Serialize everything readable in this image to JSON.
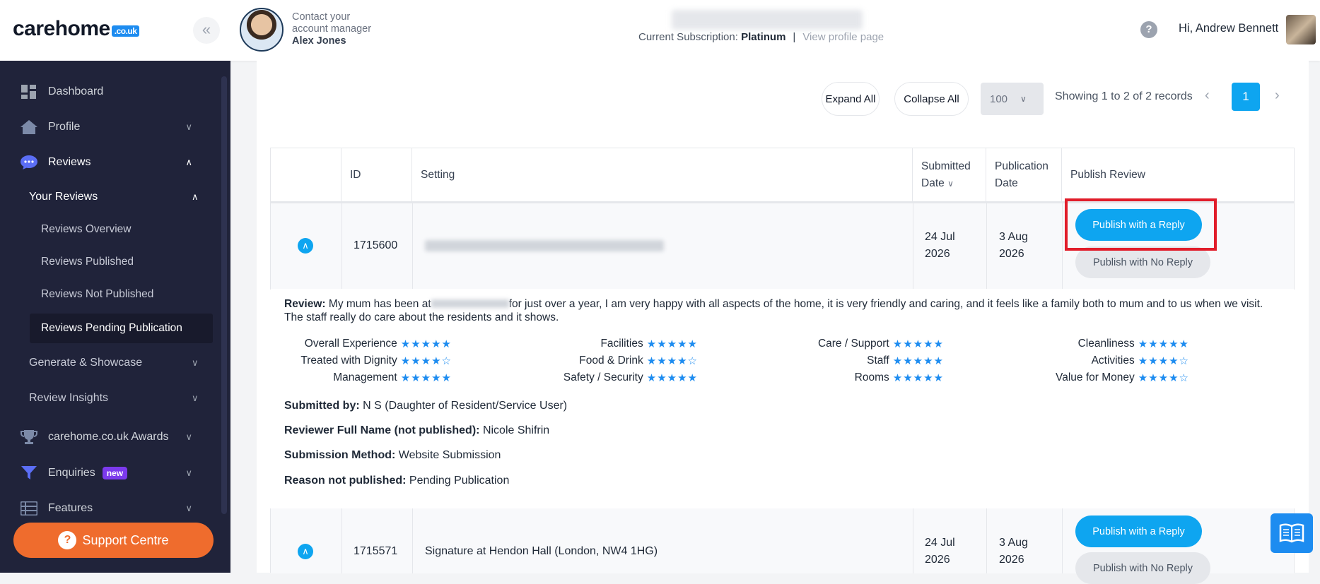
{
  "header": {
    "logo_text": "carehome",
    "logo_tld": ".co.uk",
    "collapse_icon": "«",
    "manager_line1": "Contact your",
    "manager_line2": "account manager",
    "manager_name": "Alex Jones",
    "subscription_label": "Current Subscription:",
    "subscription_value": "Platinum",
    "separator": "|",
    "view_profile": "View profile page",
    "help_icon": "?",
    "greeting": "Hi, Andrew Bennett"
  },
  "sidebar": {
    "dashboard": "Dashboard",
    "profile": "Profile",
    "reviews": "Reviews",
    "your_reviews": "Your Reviews",
    "reviews_overview": "Reviews Overview",
    "reviews_published": "Reviews Published",
    "reviews_not_published": "Reviews Not Published",
    "reviews_pending": "Reviews Pending Publication",
    "generate_showcase": "Generate & Showcase",
    "review_insights": "Review Insights",
    "awards": "carehome.co.uk Awards",
    "enquiries": "Enquiries",
    "enquiries_badge": "new",
    "features": "Features",
    "support": "Support Centre",
    "support_icon": "?"
  },
  "toolbar": {
    "expand_all": "Expand All",
    "collapse_all": "Collapse All",
    "page_size": "100",
    "showing": "Showing 1 to 2 of 2 records",
    "prev": "‹",
    "next": "›",
    "current_page": "1"
  },
  "table": {
    "headers": {
      "id": "ID",
      "setting": "Setting",
      "submitted_1": "Submitted",
      "submitted_2": "Date",
      "publication_1": "Publication",
      "publication_2": "Date",
      "publish": "Publish Review"
    },
    "rows": [
      {
        "id": "1715600",
        "submitted_day": "24 Jul",
        "submitted_year": "2026",
        "publication_day": "3 Aug",
        "publication_year": "2026",
        "publish_reply": "Publish with a Reply",
        "publish_no_reply": "Publish with No Reply"
      },
      {
        "id": "1715571",
        "setting": "Signature at Hendon Hall (London, NW4 1HG)",
        "submitted_day": "24 Jul",
        "submitted_year": "2026",
        "publication_day": "3 Aug",
        "publication_year": "2026",
        "publish_reply": "Publish with a Reply",
        "publish_no_reply": "Publish with No Reply"
      }
    ]
  },
  "detail": {
    "review_label": "Review:",
    "review_part1": "My mum has been at",
    "review_part2": "for just over a year, I am very happy with all aspects of the home, it is very friendly and caring, and it feels like a family both to mum and to us when we visit. The staff really do care about the residents and it shows.",
    "ratings": [
      {
        "label": "Overall Experience",
        "stars": "★★★★★"
      },
      {
        "label": "Treated with Dignity",
        "stars": "★★★★☆"
      },
      {
        "label": "Management",
        "stars": "★★★★★"
      },
      {
        "label": "Facilities",
        "stars": "★★★★★"
      },
      {
        "label": "Food & Drink",
        "stars": "★★★★☆"
      },
      {
        "label": "Safety / Security",
        "stars": "★★★★★"
      },
      {
        "label": "Care / Support",
        "stars": "★★★★★"
      },
      {
        "label": "Staff",
        "stars": "★★★★★"
      },
      {
        "label": "Rooms",
        "stars": "★★★★★"
      },
      {
        "label": "Cleanliness",
        "stars": "★★★★★"
      },
      {
        "label": "Activities",
        "stars": "★★★★☆"
      },
      {
        "label": "Value for Money",
        "stars": "★★★★☆"
      }
    ],
    "submitted_by_label": "Submitted by:",
    "submitted_by": "N S (Daughter of Resident/Service User)",
    "fullname_label": "Reviewer Full Name (not published):",
    "fullname": "Nicole Shifrin",
    "method_label": "Submission Method:",
    "method": "Website Submission",
    "reason_label": "Reason not published:",
    "reason": "Pending Publication"
  },
  "colors": {
    "accent": "#0ea5f0",
    "sidebar_bg": "#20233a",
    "support": "#ef6c2d",
    "highlight": "#e11d2a"
  }
}
